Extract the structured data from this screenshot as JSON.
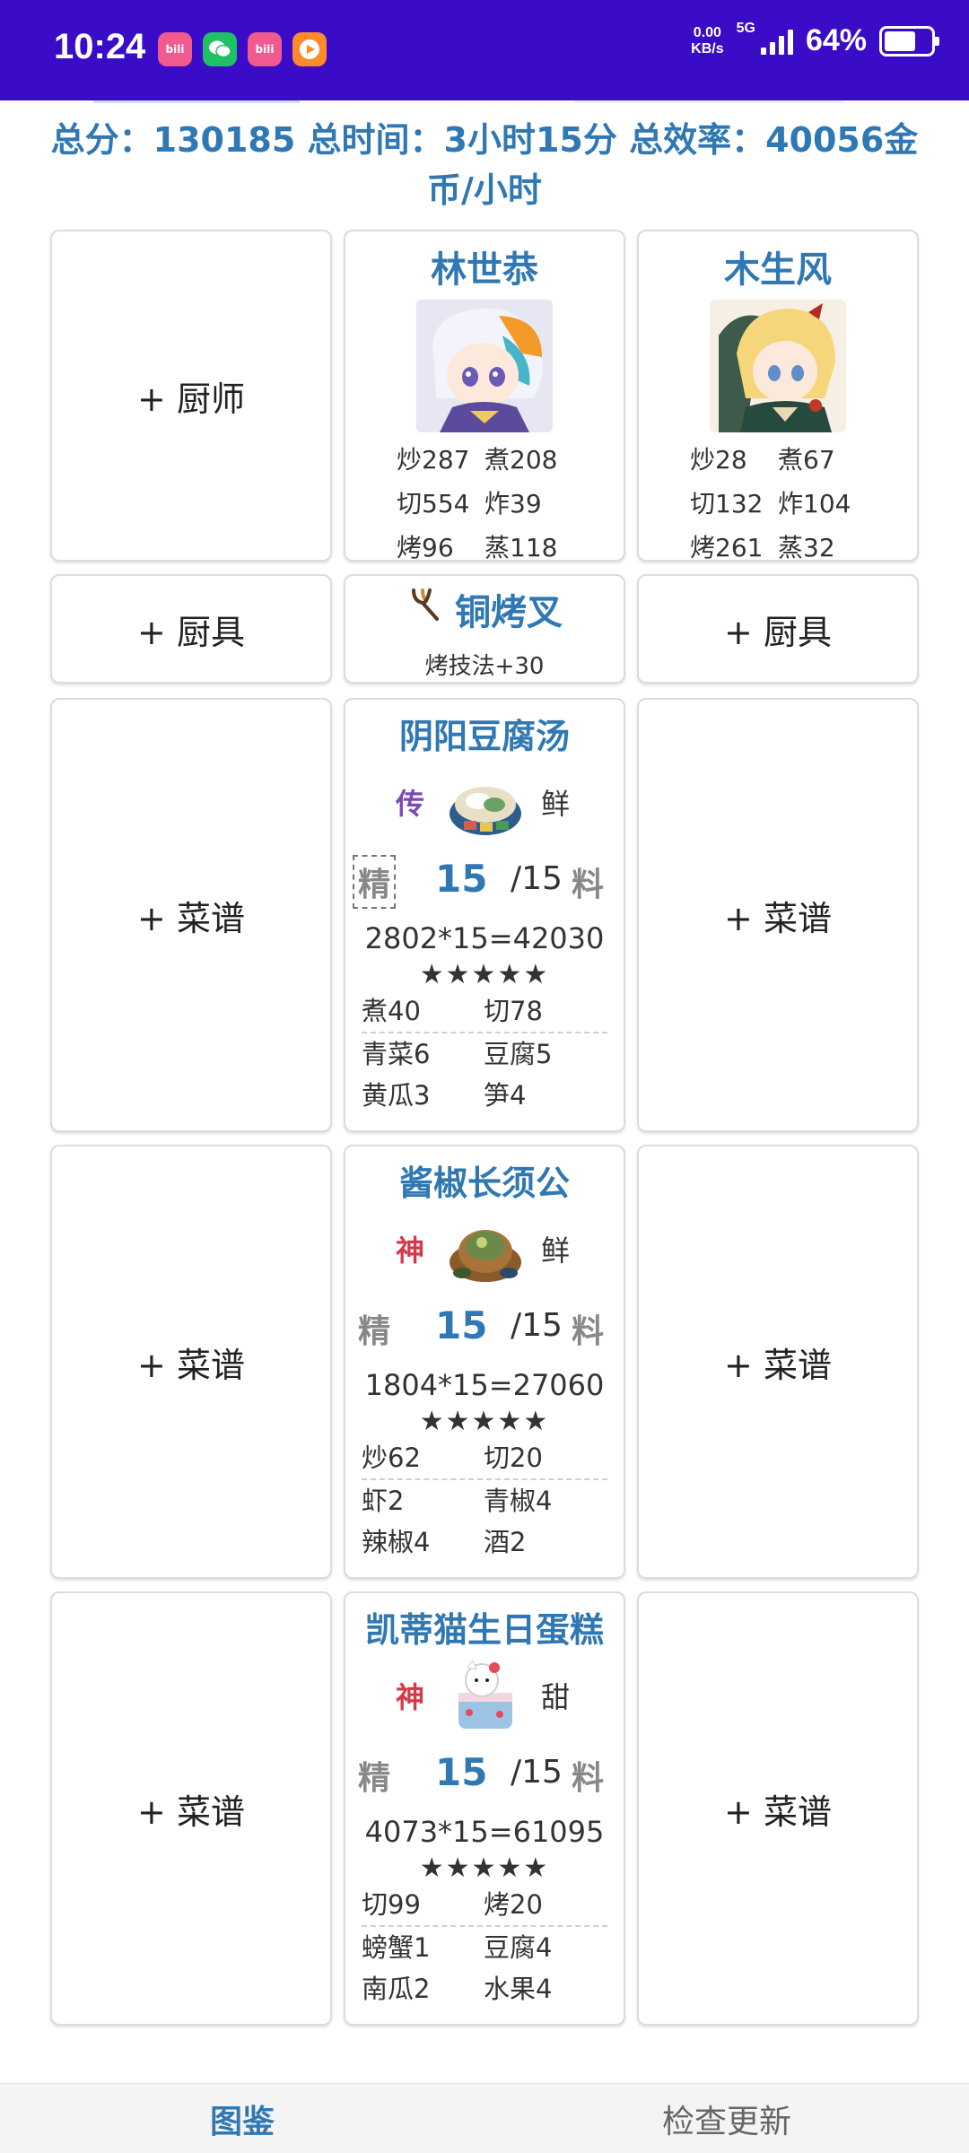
{
  "status_bar": {
    "time": "10:24",
    "net_speed_value": "0.00",
    "net_speed_unit": "KB/s",
    "network": "5G",
    "battery": "64%",
    "battery_level": 0.64,
    "apps": [
      "bilibili-icon",
      "wechat-icon",
      "bilibili-icon",
      "video-app-icon"
    ]
  },
  "summary": {
    "text": "总分：130185 总时间：3小时15分 总效率：40056金币/小时"
  },
  "add_labels": {
    "chef": "+ 厨师",
    "equip": "+ 厨具",
    "recipe": "+ 菜谱"
  },
  "chefs": [
    {
      "name": "林世恭",
      "skills": [
        "炒287",
        "煮208",
        "切554",
        "炸39",
        "烤96",
        "蒸118"
      ]
    },
    {
      "name": "木生风",
      "skills": [
        "炒28",
        "煮67",
        "切132",
        "炸104",
        "烤261",
        "蒸32"
      ]
    }
  ],
  "equipment": {
    "name": "铜烤叉",
    "desc": "烤技法+30",
    "icon": "fork-icon"
  },
  "recipes": [
    {
      "name": "阴阳豆腐汤",
      "rarity": "传",
      "rarity_color": "#7a4ab8",
      "flavor": "鲜",
      "jing": "精",
      "count": "15",
      "max": "/15",
      "liao": "料",
      "score": "2802*15=42030",
      "stars": "★★★★★",
      "skills": [
        "煮40",
        "切78"
      ],
      "ingredients": [
        "青菜6",
        "豆腐5",
        "黄瓜3",
        "笋4"
      ]
    },
    {
      "name": "酱椒长须公",
      "rarity": "神",
      "rarity_color": "#d23a4a",
      "flavor": "鲜",
      "jing": "精",
      "count": "15",
      "max": "/15",
      "liao": "料",
      "score": "1804*15=27060",
      "stars": "★★★★★",
      "skills": [
        "炒62",
        "切20"
      ],
      "ingredients": [
        "虾2",
        "青椒4",
        "辣椒4",
        "酒2"
      ]
    },
    {
      "name": "凯蒂猫生日蛋糕",
      "rarity": "神",
      "rarity_color": "#d23a4a",
      "flavor": "甜",
      "jing": "精",
      "count": "15",
      "max": "/15",
      "liao": "料",
      "score": "4073*15=61095",
      "stars": "★★★★★",
      "skills": [
        "切99",
        "烤20"
      ],
      "ingredients": [
        "螃蟹1",
        "豆腐4",
        "南瓜2",
        "水果4"
      ]
    }
  ],
  "bottom_nav": {
    "tab1": "图鉴",
    "tab2": "检查更新"
  }
}
